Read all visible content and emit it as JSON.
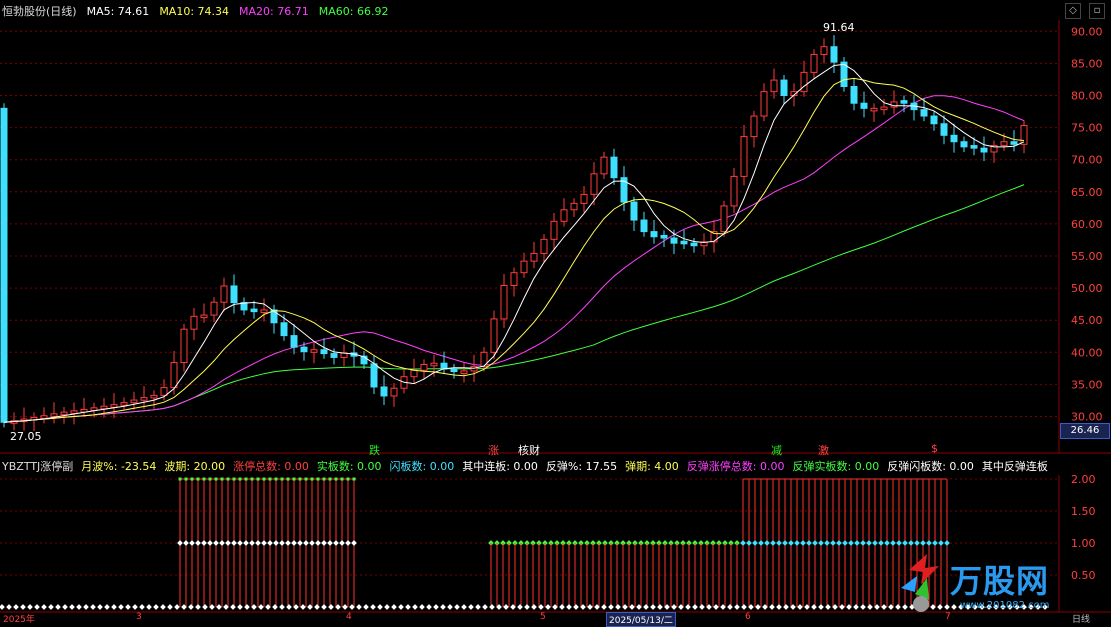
{
  "header": {
    "title": "恒勃股份(日线)",
    "ma_labels": [
      {
        "label": "MA5: 74.61",
        "color": "#ffffff"
      },
      {
        "label": "MA10: 74.34",
        "color": "#ffff55"
      },
      {
        "label": "MA20: 76.71",
        "color": "#ff40ff"
      },
      {
        "label": "MA60: 66.92",
        "color": "#40ff40"
      }
    ]
  },
  "window_buttons": {
    "min": "◇",
    "close": "▫"
  },
  "price_axis": {
    "ticks": [
      "90.00",
      "85.00",
      "80.00",
      "75.00",
      "70.00",
      "65.00",
      "60.00",
      "55.00",
      "50.00",
      "45.00",
      "40.00",
      "35.00",
      "30.00"
    ],
    "tick_values": [
      90,
      85,
      80,
      75,
      70,
      65,
      60,
      55,
      50,
      45,
      40,
      35,
      30
    ],
    "current_price": "26.46",
    "range": [
      26,
      93
    ]
  },
  "annotations": {
    "high": "91.64",
    "low": "27.05"
  },
  "markers": [
    {
      "text": "跌",
      "color": "#22ee22"
    },
    {
      "text": "涨",
      "color": "#ff4040"
    },
    {
      "text": "核财",
      "color": "#ffffff"
    },
    {
      "text": "减",
      "color": "#22ee22"
    },
    {
      "text": "激",
      "color": "#ff4040"
    },
    {
      "text": "$",
      "color": "#ff4040"
    }
  ],
  "indicator": {
    "name": "YBZTTJ涨停副",
    "fields": [
      {
        "label": "月波%: -23.54",
        "color": "#ffff55"
      },
      {
        "label": "波期: 20.00",
        "color": "#ffff55"
      },
      {
        "label": "涨停总数: 0.00",
        "color": "#ff4040"
      },
      {
        "label": "实板数: 0.00",
        "color": "#40ff40"
      },
      {
        "label": "闪板数: 0.00",
        "color": "#40e0ff"
      },
      {
        "label": "其中连板: 0.00",
        "color": "#ffffff"
      },
      {
        "label": "反弹%: 17.55",
        "color": "#ffffff"
      },
      {
        "label": "弹期: 4.00",
        "color": "#ffff55"
      },
      {
        "label": "反弹涨停总数: 0.00",
        "color": "#ff40ff"
      },
      {
        "label": "反弹实板数: 0.00",
        "color": "#40ff40"
      },
      {
        "label": "反弹闪板数: 0.00",
        "color": "#ffffff"
      },
      {
        "label": "其中反弹连板",
        "color": "#ffffff"
      }
    ],
    "axis": [
      "2.00",
      "1.50",
      "1.00",
      "0.50"
    ],
    "axis_values": [
      2,
      1.5,
      1,
      0.5
    ]
  },
  "date_axis": {
    "labels": [
      "2025年",
      "3",
      "4",
      "5",
      "2025/05/13/二",
      "6",
      "7"
    ],
    "right_label": "日线"
  },
  "brand": {
    "logo_text": "万股网",
    "url": "www.201082.com"
  },
  "colors": {
    "up": "#ff3b3b",
    "down": "#3fe0ff",
    "grid": "#7a0000",
    "ma5": "#ffffff",
    "ma10": "#ffff55",
    "ma20": "#ff40ff",
    "ma60": "#40ff40"
  }
}
